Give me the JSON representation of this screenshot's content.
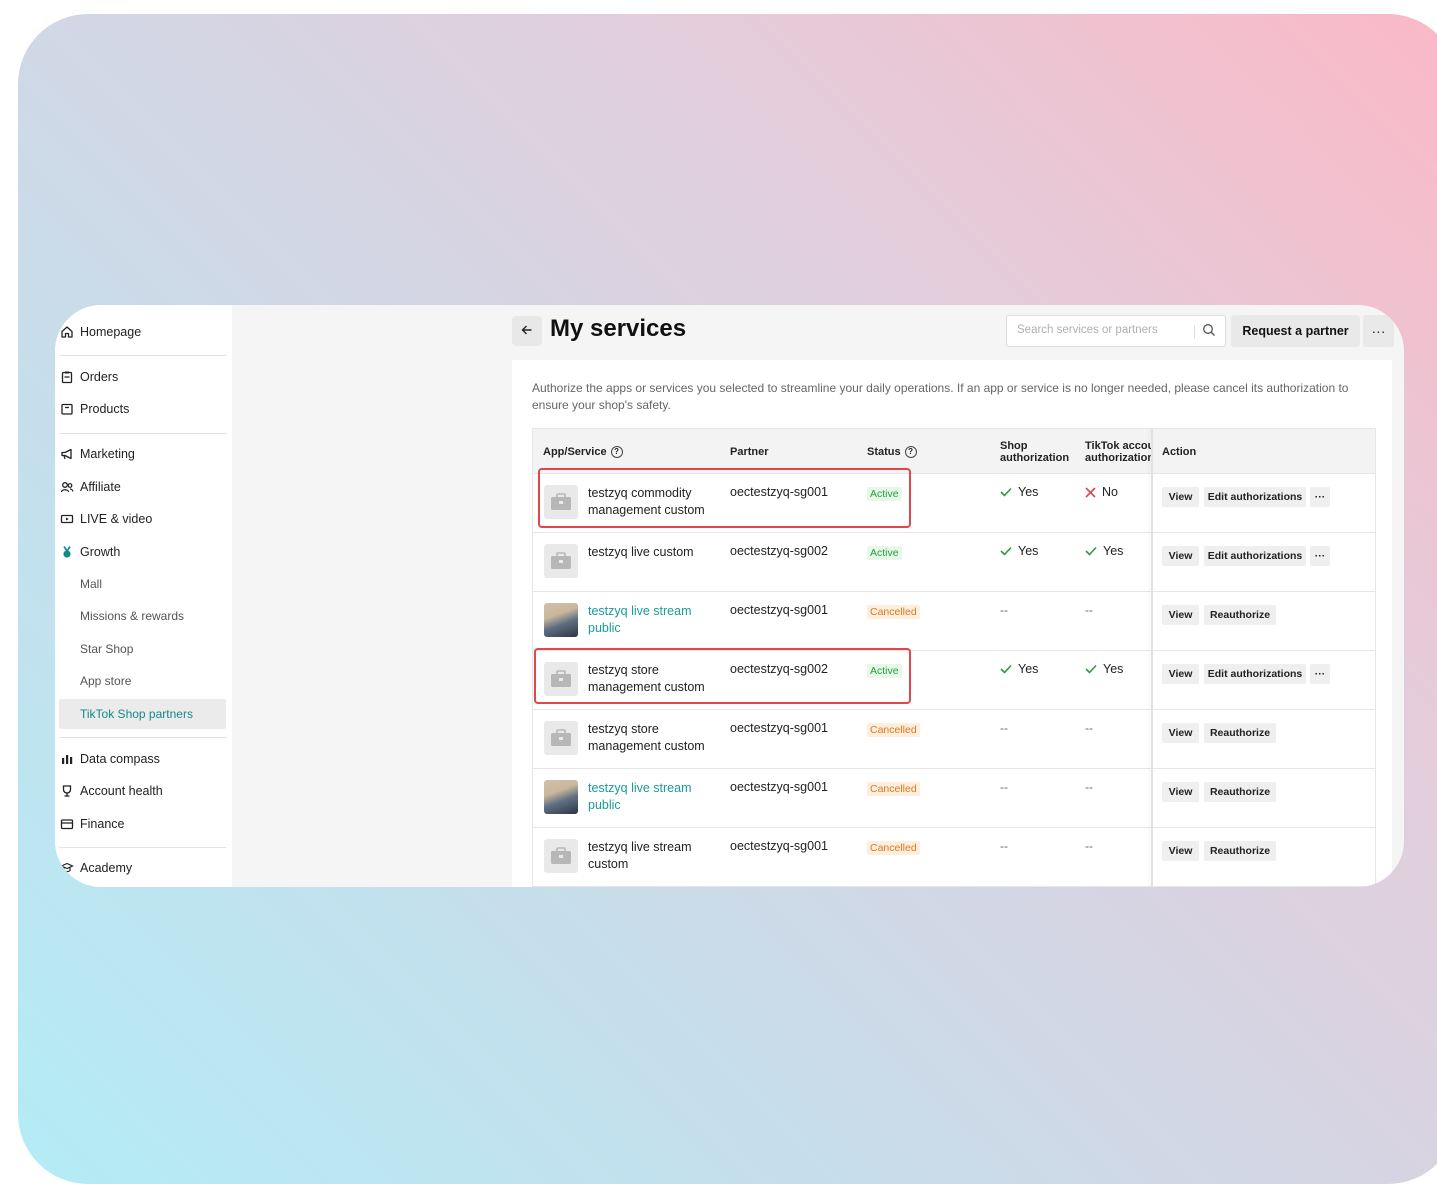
{
  "sidebar": {
    "items": [
      {
        "label": "Homepage",
        "icon": "home-icon"
      },
      {
        "label": "Orders",
        "icon": "clipboard-icon"
      },
      {
        "label": "Products",
        "icon": "box-icon"
      },
      {
        "label": "Marketing",
        "icon": "megaphone-icon"
      },
      {
        "label": "Affiliate",
        "icon": "users-icon"
      },
      {
        "label": "LIVE & video",
        "icon": "video-icon"
      },
      {
        "label": "Growth",
        "icon": "medal-icon"
      },
      {
        "label": "Mall"
      },
      {
        "label": "Missions & rewards"
      },
      {
        "label": "Star Shop"
      },
      {
        "label": "App store"
      },
      {
        "label": "TikTok Shop partners",
        "active": true
      },
      {
        "label": "Data compass",
        "icon": "chart-icon"
      },
      {
        "label": "Account health",
        "icon": "trophy-icon"
      },
      {
        "label": "Finance",
        "icon": "wallet-icon"
      },
      {
        "label": "Academy",
        "icon": "graduation-cap-icon"
      }
    ]
  },
  "header": {
    "title": "My services",
    "search_placeholder": "Search services or partners",
    "request_label": "Request a partner",
    "more_label": "···"
  },
  "description": "Authorize the apps or services you selected to streamline your daily operations. If an app or service is no longer needed, please cancel its authorization to ensure your shop's safety.",
  "table": {
    "columns": {
      "app": "App/Service",
      "partner": "Partner",
      "status": "Status",
      "shop_auth_1": "Shop",
      "shop_auth_2": "authorization",
      "tiktok_auth_1": "TikTok accour",
      "tiktok_auth_2": "authorization",
      "action": "Action"
    },
    "rows": [
      {
        "name_1": "testzyq commodity",
        "name_2": "management custom",
        "partner": "oectestzyq-sg001",
        "status": "Active",
        "shop": "Yes",
        "tiktok": "No",
        "view": "View",
        "edit": "Edit authorizations",
        "more": "···"
      },
      {
        "name_1": "testzyq live custom",
        "name_2": "",
        "partner": "oectestzyq-sg002",
        "status": "Active",
        "shop": "Yes",
        "tiktok": "Yes",
        "view": "View",
        "edit": "Edit authorizations",
        "more": "···"
      },
      {
        "name_1": "testzyq live stream",
        "name_2": "public",
        "partner": "oectestzyq-sg001",
        "status": "Cancelled",
        "shop": "--",
        "tiktok": "--",
        "view": "View",
        "reauth": "Reauthorize"
      },
      {
        "name_1": "testzyq store",
        "name_2": "management custom",
        "partner": "oectestzyq-sg002",
        "status": "Active",
        "shop": "Yes",
        "tiktok": "Yes",
        "view": "View",
        "edit": "Edit authorizations",
        "more": "···"
      },
      {
        "name_1": "testzyq store",
        "name_2": "management custom",
        "partner": "oectestzyq-sg001",
        "status": "Cancelled",
        "shop": "--",
        "tiktok": "--",
        "view": "View",
        "reauth": "Reauthorize"
      },
      {
        "name_1": "testzyq live stream",
        "name_2": "public",
        "partner": "oectestzyq-sg001",
        "status": "Cancelled",
        "shop": "--",
        "tiktok": "--",
        "view": "View",
        "reauth": "Reauthorize"
      },
      {
        "name_1": "testzyq live stream",
        "name_2": "custom",
        "partner": "oectestzyq-sg001",
        "status": "Cancelled",
        "shop": "--",
        "tiktok": "--",
        "view": "View",
        "reauth": "Reauthorize"
      }
    ]
  },
  "colors": {
    "accent": "#1a9b9b",
    "highlight": "#e0474c",
    "active": "#22a13a",
    "cancelled": "#e0781b"
  }
}
